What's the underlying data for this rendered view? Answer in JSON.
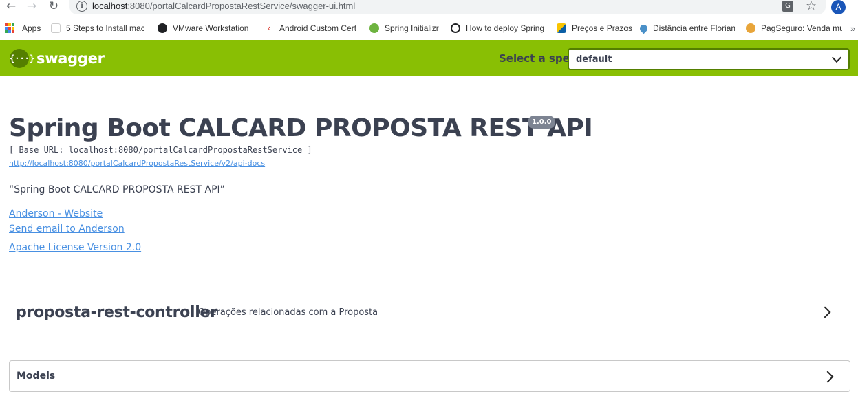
{
  "browser": {
    "url_host": "localhost",
    "url_rest": ":8080/portalCalcardPropostaRestService/swagger-ui.html",
    "avatar_letter": "A",
    "nav_icons": [
      "back-arrow-icon",
      "forward-arrow-icon",
      "reload-icon"
    ],
    "bookmarks": [
      {
        "label": "Apps",
        "icon": "apps-grid-icon"
      },
      {
        "label": "5 Steps to Install mac",
        "icon": "bookmark-favicon"
      },
      {
        "label": "VMware Workstation",
        "icon": "bookmark-favicon"
      },
      {
        "label": "Android Custom Cert",
        "icon": "bookmark-favicon"
      },
      {
        "label": "Spring Initializr",
        "icon": "spring-leaf-icon"
      },
      {
        "label": "How to deploy Spring",
        "icon": "bookmark-favicon"
      },
      {
        "label": "Preços e Prazos",
        "icon": "bookmark-favicon"
      },
      {
        "label": "Distância entre Florian",
        "icon": "map-pin-icon"
      },
      {
        "label": "PagSeguro: Venda mu",
        "icon": "bookmark-favicon"
      }
    ]
  },
  "swagger": {
    "logo_glyph": "{···}",
    "brand": "swagger",
    "spec_label": "Select a spec",
    "spec_value": "default",
    "header_color": "#89bf04"
  },
  "info": {
    "title": "Spring Boot CALCARD PROPOSTA REST API",
    "version": "1.0.0",
    "base_url": "[ Base URL: localhost:8080/portalCalcardPropostaRestService ]",
    "api_docs_url": "http://localhost:8080/portalCalcardPropostaRestService/v2/api-docs",
    "description": "“Spring Boot CALCARD PROPOSTA REST API”",
    "contact_website": "Anderson - Website",
    "contact_email": "Send email to Anderson",
    "license": "Apache License Version 2.0"
  },
  "controller": {
    "name": "proposta-rest-controller",
    "description": "Operações relacionadas com a Proposta"
  },
  "models": {
    "label": "Models"
  }
}
